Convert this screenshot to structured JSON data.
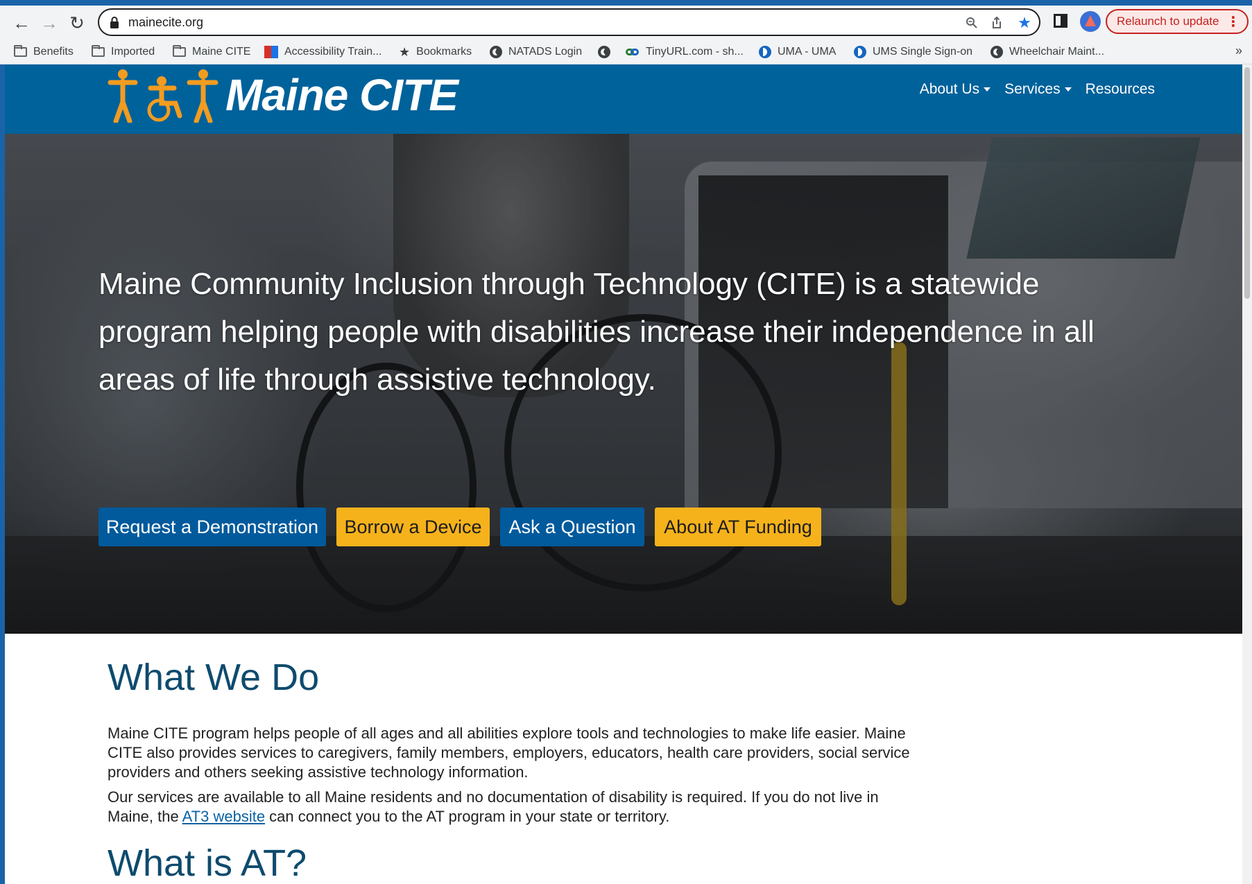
{
  "browser": {
    "url": "mainecite.org",
    "relaunch_label": "Relaunch to update",
    "bookmarks": [
      {
        "label": "Benefits",
        "icon": "folder-icon"
      },
      {
        "label": "Imported",
        "icon": "folder-icon"
      },
      {
        "label": "Maine CITE",
        "icon": "folder-icon"
      },
      {
        "label": "Accessibility Train...",
        "icon": "accessibility-icon"
      },
      {
        "label": "Bookmarks",
        "icon": "star-icon"
      },
      {
        "label": "NATADS Login",
        "icon": "globe-icon"
      },
      {
        "label": "",
        "icon": "globe-icon"
      },
      {
        "label": "TinyURL.com - sh...",
        "icon": "tinyurl-icon"
      },
      {
        "label": "UMA - UMA",
        "icon": "uma-icon"
      },
      {
        "label": "UMS Single Sign-on",
        "icon": "uma-icon"
      },
      {
        "label": "Wheelchair Maint...",
        "icon": "globe-icon"
      }
    ],
    "more_label": "»"
  },
  "site": {
    "logo_text": "Maine CITE",
    "nav": {
      "about": "About Us",
      "services": "Services",
      "resources": "Resources"
    }
  },
  "hero": {
    "text": "Maine Community Inclusion through Technology (CITE) is a statewide program helping people with disabilities increase their independence in all areas of life through assistive technology.",
    "buttons": {
      "demo": "Request a Demonstration",
      "borrow": "Borrow a Device",
      "ask": "Ask a Question",
      "funding": "About AT Funding"
    }
  },
  "what_we_do": {
    "heading": "What We Do",
    "p1": "Maine CITE program helps people of all ages and all abilities explore tools and technologies to make life easier. Maine CITE also provides services to caregivers, family members, employers, educators, health care providers, social service providers and others seeking assistive technology information.",
    "p2_before": "Our services are available to all Maine residents and no documentation of disability is required. If you do not live in Maine, the ",
    "p2_link": "AT3 website",
    "p2_after": " can connect you to the AT program in your state or territory."
  },
  "what_is_at": {
    "heading": "What is AT?"
  },
  "colors": {
    "header_blue": "#00629b",
    "button_blue": "#005a9c",
    "button_gold": "#f5b21b",
    "heading_blue": "#0e4b6e",
    "logo_orange": "#f39c1f"
  }
}
